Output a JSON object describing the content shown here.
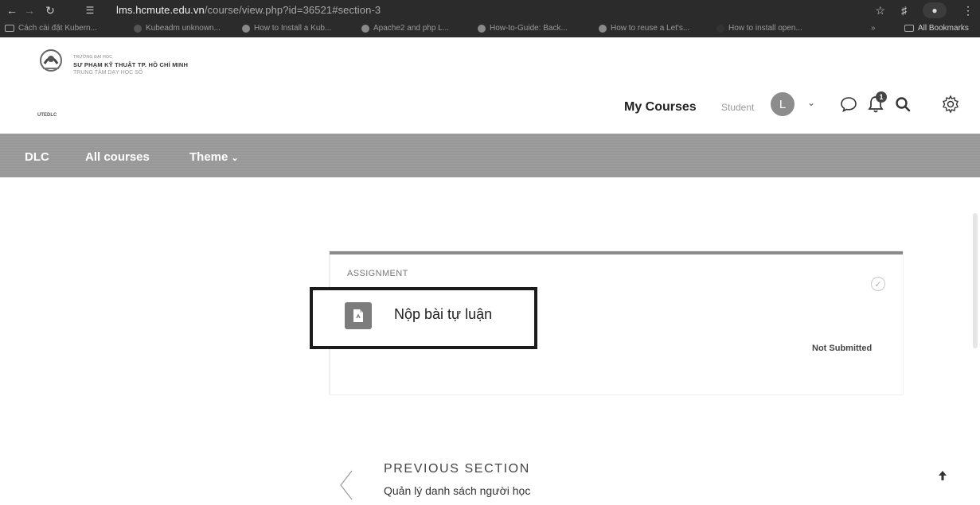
{
  "browser": {
    "url_host": "lms.hcmute.edu.vn",
    "url_rest": "/course/view.php?id=36521#section-3",
    "bookmarks": [
      "Cách cài đặt Kubern...",
      "Kubeadm unknown...",
      "How to Install a Kub...",
      "Apache2 and php L...",
      "How-to-Guide: Back...",
      "How to reuse a Let's...",
      "How to install open...",
      "»",
      "All Bookmarks"
    ]
  },
  "header": {
    "logo_line1": "TRƯỜNG ĐẠI HỌC",
    "logo_line2": "SƯ PHẠM KỸ THUẬT TP. HỒ CHÍ MINH",
    "logo_line3": "TRUNG TÂM DẠY HỌC SỐ",
    "logo_abbr": "UTEDLC",
    "my_courses": "My Courses",
    "role": "Student",
    "avatar_initial": "L",
    "notification_count": "1"
  },
  "nav": {
    "items": [
      "DLC",
      "All courses",
      "Theme"
    ]
  },
  "activity": {
    "type_label": "ASSIGNMENT",
    "title": "Nộp bài tự luận",
    "status": "Not Submitted"
  },
  "section_nav": {
    "prev_label": "PREVIOUS SECTION",
    "prev_title": "Quản lý danh sách người học"
  },
  "icons": {
    "back": "arrow-left-icon",
    "forward": "arrow-right-icon",
    "reload": "reload-icon",
    "bookmark_star": "star-icon",
    "extensions": "puzzle-icon",
    "messages": "chat-bubble-icon",
    "notifications": "bell-icon",
    "search": "search-icon",
    "settings": "gear-icon",
    "assignment": "file-icon",
    "previous": "chevron-left-icon",
    "to_top": "arrow-up-icon"
  }
}
